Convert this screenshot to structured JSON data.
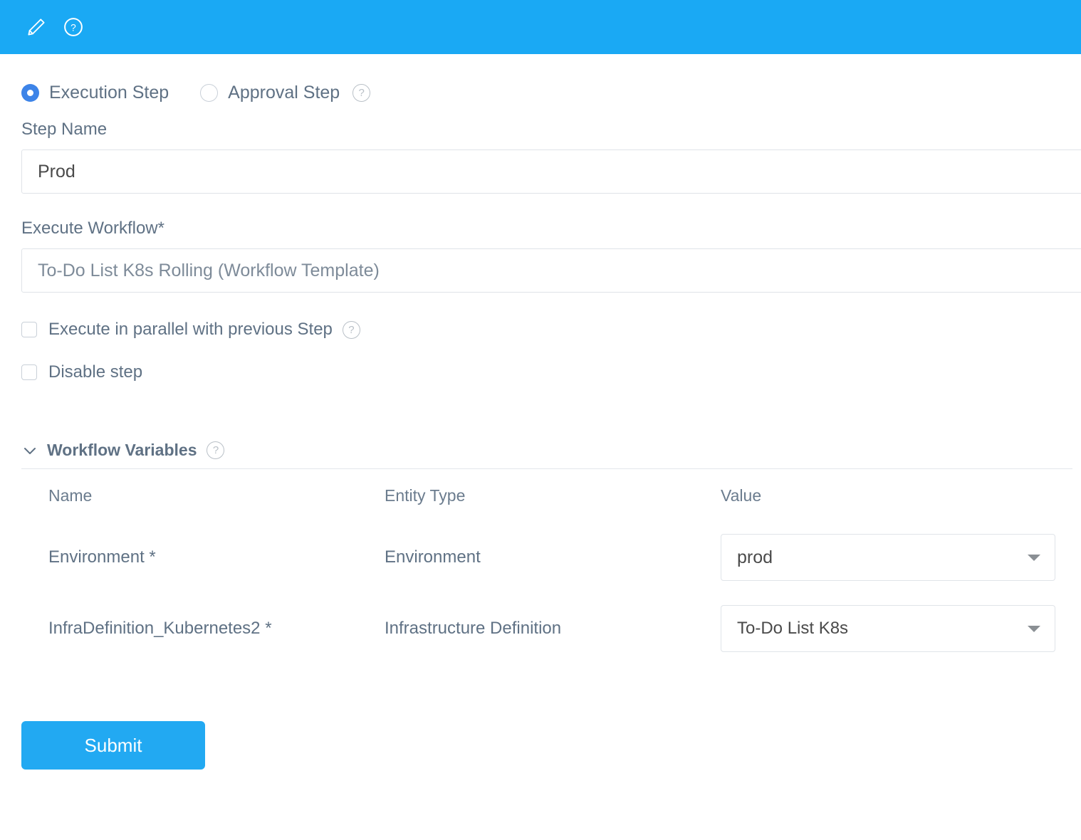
{
  "header": {
    "edit_icon": "pencil-icon",
    "help_icon": "help-circle-icon",
    "background_color": "#1aa9f4"
  },
  "step_type": {
    "options": [
      {
        "label": "Execution Step",
        "selected": true
      },
      {
        "label": "Approval Step",
        "selected": false
      }
    ],
    "help_icon": "help-circle-icon",
    "selected_color": "#3d84e8"
  },
  "step_name": {
    "label": "Step Name",
    "value": "Prod",
    "placeholder": "Step Name"
  },
  "execute_workflow": {
    "label": "Execute Workflow*",
    "value": "To-Do List K8s Rolling (Workflow Template)",
    "placeholder": "Execute Workflow"
  },
  "checkboxes": [
    {
      "label": "Execute in parallel with previous Step",
      "checked": false,
      "has_help": true
    },
    {
      "label": "Disable step",
      "checked": false,
      "has_help": false
    }
  ],
  "workflow_variables": {
    "title": "Workflow Variables",
    "expanded": true,
    "chevron_icon": "chevron-down-icon",
    "help_icon": "help-circle-icon",
    "columns": [
      "Name",
      "Entity Type",
      "Value"
    ],
    "rows": [
      {
        "name": "Environment *",
        "entity_type": "Environment",
        "value": "prod"
      },
      {
        "name": "InfraDefinition_Kubernetes2 *",
        "entity_type": "Infrastructure Definition",
        "value": "To-Do List K8s"
      }
    ]
  },
  "submit": {
    "label": "Submit",
    "color": "#22a9f2"
  }
}
